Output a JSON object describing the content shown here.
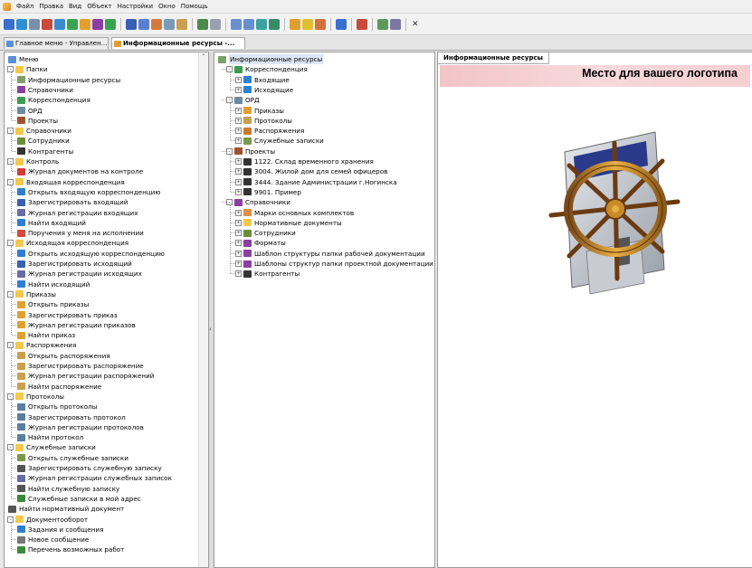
{
  "menu_bar": {
    "items": [
      "Файл",
      "Правка",
      "Вид",
      "Объект",
      "Настройки",
      "Окно",
      "Помощь"
    ]
  },
  "tabs": [
    {
      "label": "Главное меню - Управлен...",
      "active": false,
      "icon": "window-icon"
    },
    {
      "label": "Информационные ресурсы -...",
      "active": true,
      "icon": "folder-star-icon"
    }
  ],
  "left_tree": {
    "rows": [
      {
        "label": "Меню",
        "level": 0,
        "icon": "menu-icon",
        "color": "#5b8fd6",
        "exp": ""
      },
      {
        "label": "Папки",
        "level": 0,
        "icon": "folder-icon",
        "color": "#f2c94c",
        "exp": "-"
      },
      {
        "label": "Информационные ресурсы",
        "level": 1,
        "icon": "info-resources-icon",
        "color": "#7ca06a",
        "exp": ""
      },
      {
        "label": "Справочники",
        "level": 1,
        "icon": "directory-icon",
        "color": "#8b3fa0",
        "exp": ""
      },
      {
        "label": "Корреспонденция",
        "level": 1,
        "icon": "correspondence-icon",
        "color": "#3c9d4f",
        "exp": ""
      },
      {
        "label": "ОРД",
        "level": 1,
        "icon": "ord-icon",
        "color": "#6c8aa3",
        "exp": ""
      },
      {
        "label": "Проекты",
        "level": 1,
        "icon": "projects-icon",
        "color": "#a0522d",
        "exp": ""
      },
      {
        "label": "Справочники",
        "level": 0,
        "icon": "folder-icon",
        "color": "#f2c94c",
        "exp": "-"
      },
      {
        "label": "Сотрудники",
        "level": 1,
        "icon": "employees-icon",
        "color": "#6a8f3a",
        "exp": ""
      },
      {
        "label": "Контрагенты",
        "level": 1,
        "icon": "contractors-icon",
        "color": "#333333",
        "exp": ""
      },
      {
        "label": "Контроль",
        "level": 0,
        "icon": "folder-icon",
        "color": "#f2c94c",
        "exp": "-"
      },
      {
        "label": "Журнал документов на контроле",
        "level": 1,
        "icon": "journal-icon",
        "color": "#d43a3a",
        "exp": ""
      },
      {
        "label": "Входящая корреспонденция",
        "level": 0,
        "icon": "folder-icon",
        "color": "#f2c94c",
        "exp": "-"
      },
      {
        "label": "Открыть входящую корреспонденцию",
        "level": 1,
        "icon": "open-icon",
        "color": "#2f7fd1",
        "exp": ""
      },
      {
        "label": "Зарегистрировать входящий",
        "level": 1,
        "icon": "register-icon",
        "color": "#3a5fb0",
        "exp": ""
      },
      {
        "label": "Журнал регистрации входящих",
        "level": 1,
        "icon": "journal-icon",
        "color": "#6a6aa6",
        "exp": ""
      },
      {
        "label": "Найти входящий",
        "level": 1,
        "icon": "find-icon",
        "color": "#2f7fd1",
        "exp": ""
      },
      {
        "label": "Поручения у меня на исполнении",
        "level": 1,
        "icon": "task-icon",
        "color": "#d44a3a",
        "exp": ""
      },
      {
        "label": "Исходящая корреспонденция",
        "level": 0,
        "icon": "folder-icon",
        "color": "#f2c94c",
        "exp": "-"
      },
      {
        "label": "Открыть исходящую корреспонденцию",
        "level": 1,
        "icon": "open-icon",
        "color": "#2f7fd1",
        "exp": ""
      },
      {
        "label": "Зарегистрировать исходящий",
        "level": 1,
        "icon": "register-icon",
        "color": "#3a5fb0",
        "exp": ""
      },
      {
        "label": "Журнал регистрации исходящих",
        "level": 1,
        "icon": "journal-icon",
        "color": "#6a6aa6",
        "exp": ""
      },
      {
        "label": "Найти исходящий",
        "level": 1,
        "icon": "find-icon",
        "color": "#2f7fd1",
        "exp": ""
      },
      {
        "label": "Приказы",
        "level": 0,
        "icon": "folder-icon",
        "color": "#f2c94c",
        "exp": "-"
      },
      {
        "label": "Открыть приказы",
        "level": 1,
        "icon": "open-icon",
        "color": "#e0a030",
        "exp": ""
      },
      {
        "label": "Зарегистрировать приказ",
        "level": 1,
        "icon": "register-icon",
        "color": "#e0a030",
        "exp": ""
      },
      {
        "label": "Журнал регистрации приказов",
        "level": 1,
        "icon": "journal-icon",
        "color": "#e0a030",
        "exp": ""
      },
      {
        "label": "Найти приказ",
        "level": 1,
        "icon": "find-icon",
        "color": "#e0a030",
        "exp": ""
      },
      {
        "label": "Распоряжения",
        "level": 0,
        "icon": "folder-icon",
        "color": "#f2c94c",
        "exp": "-"
      },
      {
        "label": "Открыть распоряжения",
        "level": 1,
        "icon": "open-icon",
        "color": "#c9a050",
        "exp": ""
      },
      {
        "label": "Зарегистрировать распоряжение",
        "level": 1,
        "icon": "register-icon",
        "color": "#c9a050",
        "exp": ""
      },
      {
        "label": "Журнал регистрации распоряжений",
        "level": 1,
        "icon": "journal-icon",
        "color": "#c9a050",
        "exp": ""
      },
      {
        "label": "Найти распоряжение",
        "level": 1,
        "icon": "find-icon",
        "color": "#c9a050",
        "exp": ""
      },
      {
        "label": "Протоколы",
        "level": 0,
        "icon": "folder-icon",
        "color": "#f2c94c",
        "exp": "-"
      },
      {
        "label": "Открыть протоколы",
        "level": 1,
        "icon": "open-icon",
        "color": "#5a7fa0",
        "exp": ""
      },
      {
        "label": "Зарегистрировать протокол",
        "level": 1,
        "icon": "register-icon",
        "color": "#5a7fa0",
        "exp": ""
      },
      {
        "label": "Журнал регистрации протоколов",
        "level": 1,
        "icon": "journal-icon",
        "color": "#5a7fa0",
        "exp": ""
      },
      {
        "label": "Найти протокол",
        "level": 1,
        "icon": "find-icon",
        "color": "#5a7fa0",
        "exp": ""
      },
      {
        "label": "Служебные записки",
        "level": 0,
        "icon": "folder-icon",
        "color": "#f2c94c",
        "exp": "-"
      },
      {
        "label": "Открыть служебные записки",
        "level": 1,
        "icon": "open-icon",
        "color": "#7a9a4a",
        "exp": ""
      },
      {
        "label": "Зарегистрировать служебную записку",
        "level": 1,
        "icon": "register-icon",
        "color": "#555555",
        "exp": ""
      },
      {
        "label": "Журнал регистрации служебных записок",
        "level": 1,
        "icon": "journal-icon",
        "color": "#6a6aa6",
        "exp": ""
      },
      {
        "label": "Найти служебную записку",
        "level": 1,
        "icon": "find-icon",
        "color": "#555555",
        "exp": ""
      },
      {
        "label": "Служебные записки в мой адрес",
        "level": 1,
        "icon": "memo-icon",
        "color": "#3a8a3a",
        "exp": ""
      },
      {
        "label": "Найти нормативный документ",
        "level": 0,
        "icon": "find-normative-icon",
        "color": "#555555",
        "exp": ""
      },
      {
        "label": "Документооборот",
        "level": 0,
        "icon": "folder-icon",
        "color": "#f2c94c",
        "exp": "-"
      },
      {
        "label": "Задания и сообщения",
        "level": 1,
        "icon": "tasks-icon",
        "color": "#2f7fd1",
        "exp": ""
      },
      {
        "label": "Новое сообщение",
        "level": 1,
        "icon": "message-icon",
        "color": "#777777",
        "exp": ""
      },
      {
        "label": "Перечень возможных работ",
        "level": 1,
        "icon": "works-icon",
        "color": "#3a8a3a",
        "exp": ""
      }
    ]
  },
  "middle_tree": {
    "rows": [
      {
        "label": "Информационные ресурсы",
        "level": 0,
        "icon": "info-resources-icon",
        "color": "#7ca06a",
        "exp": "",
        "selected": true
      },
      {
        "label": "Корреспонденция",
        "level": 1,
        "icon": "correspondence-icon",
        "color": "#3c9d4f",
        "exp": "-"
      },
      {
        "label": "Входящие",
        "level": 2,
        "icon": "incoming-icon",
        "color": "#2f7fd1",
        "exp": "+"
      },
      {
        "label": "Исходящие",
        "level": 2,
        "icon": "outgoing-icon",
        "color": "#2f7fd1",
        "exp": "+"
      },
      {
        "label": "ОРД",
        "level": 1,
        "icon": "ord-icon",
        "color": "#6c8aa3",
        "exp": "-"
      },
      {
        "label": "Приказы",
        "level": 2,
        "icon": "orders-icon",
        "color": "#e0a030",
        "exp": "+"
      },
      {
        "label": "Протоколы",
        "level": 2,
        "icon": "protocols-icon",
        "color": "#c9a050",
        "exp": "+"
      },
      {
        "label": "Распоряжения",
        "level": 2,
        "icon": "directives-icon",
        "color": "#c97a30",
        "exp": "+"
      },
      {
        "label": "Служебные записки",
        "level": 2,
        "icon": "memos-icon",
        "color": "#7a9a4a",
        "exp": "+"
      },
      {
        "label": "Проекты",
        "level": 1,
        "icon": "projects-icon",
        "color": "#a0522d",
        "exp": "-"
      },
      {
        "label": "1122. Склад временного хранения",
        "level": 2,
        "icon": "project-icon",
        "color": "#333333",
        "exp": "+"
      },
      {
        "label": "3004. Жилой дом для семей офицеров",
        "level": 2,
        "icon": "project-icon",
        "color": "#333333",
        "exp": "+"
      },
      {
        "label": "3444. Здание Администрации г.Ногинска",
        "level": 2,
        "icon": "project-icon",
        "color": "#333333",
        "exp": "+"
      },
      {
        "label": "9901. Пример",
        "level": 2,
        "icon": "project-icon",
        "color": "#333333",
        "exp": "+"
      },
      {
        "label": "Справочники",
        "level": 1,
        "icon": "directory-icon",
        "color": "#8b3fa0",
        "exp": "-"
      },
      {
        "label": "Марки основных комплектов",
        "level": 2,
        "icon": "folder-icon",
        "color": "#e09040",
        "exp": "+"
      },
      {
        "label": "Нормативные документы",
        "level": 2,
        "icon": "folder-icon",
        "color": "#f2c94c",
        "exp": "+"
      },
      {
        "label": "Сотрудники",
        "level": 2,
        "icon": "employees-icon",
        "color": "#6a8f3a",
        "exp": "+"
      },
      {
        "label": "Форматы",
        "level": 2,
        "icon": "formats-icon",
        "color": "#8b3fa0",
        "exp": "+"
      },
      {
        "label": "Шаблон структуры папки рабочей документации",
        "level": 2,
        "icon": "template-icon",
        "color": "#8b3fa0",
        "exp": "+"
      },
      {
        "label": "Шаблоны структур папки проектной документации",
        "level": 2,
        "icon": "template-icon",
        "color": "#8b3fa0",
        "exp": "+"
      },
      {
        "label": "Контрагенты",
        "level": 2,
        "icon": "contractors-icon",
        "color": "#333333",
        "exp": "+"
      }
    ]
  },
  "right_pane": {
    "tab_label": "Информационные ресурсы",
    "logo_text": "Место для вашего логотипа",
    "image_icon": "ship-wheel-logo-icon"
  }
}
